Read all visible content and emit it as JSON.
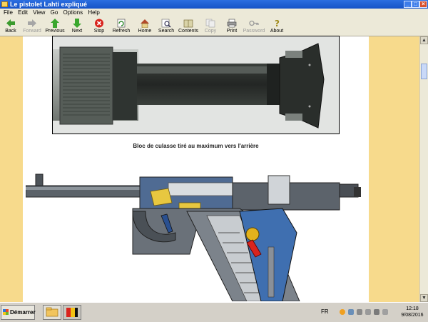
{
  "window": {
    "title": "Le pistolet Lahti expliqué"
  },
  "menu": [
    "File",
    "Edit",
    "View",
    "Go",
    "Options",
    "Help"
  ],
  "toolbar": {
    "back": "Back",
    "forward": "Forward",
    "previous": "Previous",
    "next": "Next",
    "stop": "Stop",
    "refresh": "Refresh",
    "home": "Home",
    "search": "Search",
    "contents": "Contents",
    "copy": "Copy",
    "print": "Print",
    "password": "Password",
    "about": "About"
  },
  "page": {
    "caption": "Bloc de culasse tiré au maximum vers l'arrière"
  },
  "taskbar": {
    "start": "Démarrer",
    "lang": "FR",
    "time": "12:18",
    "date": "9/08/2016"
  }
}
